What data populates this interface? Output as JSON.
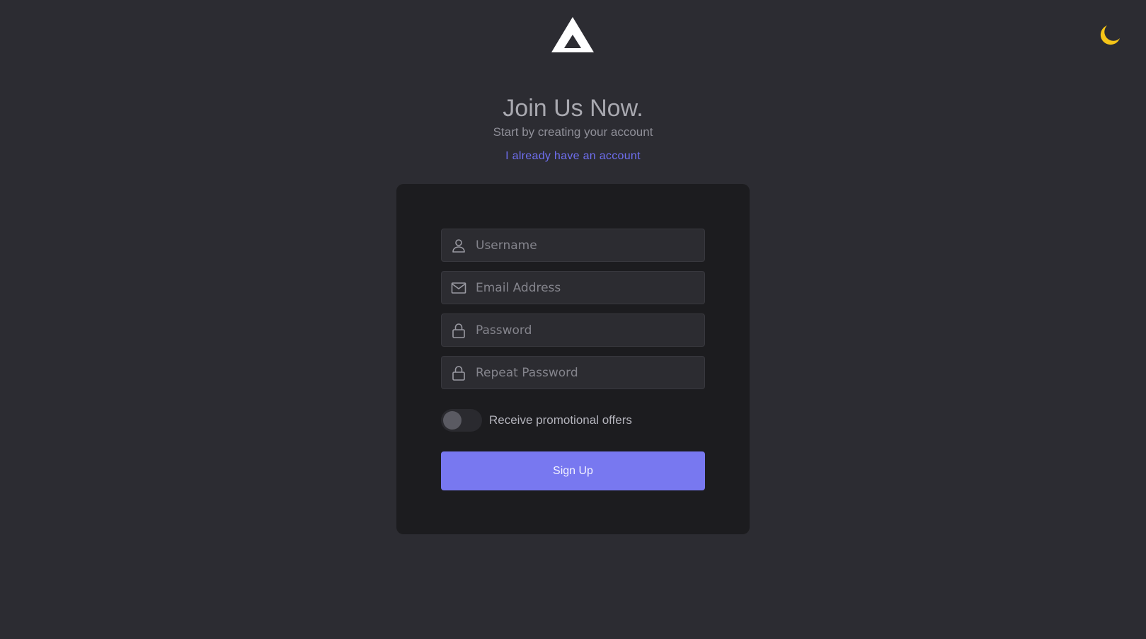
{
  "header": {
    "title": "Join Us Now.",
    "subtitle": "Start by creating your account",
    "login_link": "I already have an account"
  },
  "form": {
    "fields": [
      {
        "placeholder": "Username",
        "value": "",
        "icon": "user-icon"
      },
      {
        "placeholder": "Email Address",
        "value": "",
        "icon": "mail-icon"
      },
      {
        "placeholder": "Password",
        "value": "",
        "icon": "lock-icon"
      },
      {
        "placeholder": "Repeat Password",
        "value": "",
        "icon": "lock-icon"
      }
    ],
    "promo_toggle": {
      "label": "Receive promotional offers",
      "checked": false
    },
    "submit_label": "Sign Up"
  },
  "theme_toggle": {
    "icon": "moon-icon",
    "color": "#f5c518"
  },
  "colors": {
    "background": "#2c2c32",
    "card": "#1c1c1f",
    "accent": "#7878f0",
    "link": "#6f6ff0"
  }
}
